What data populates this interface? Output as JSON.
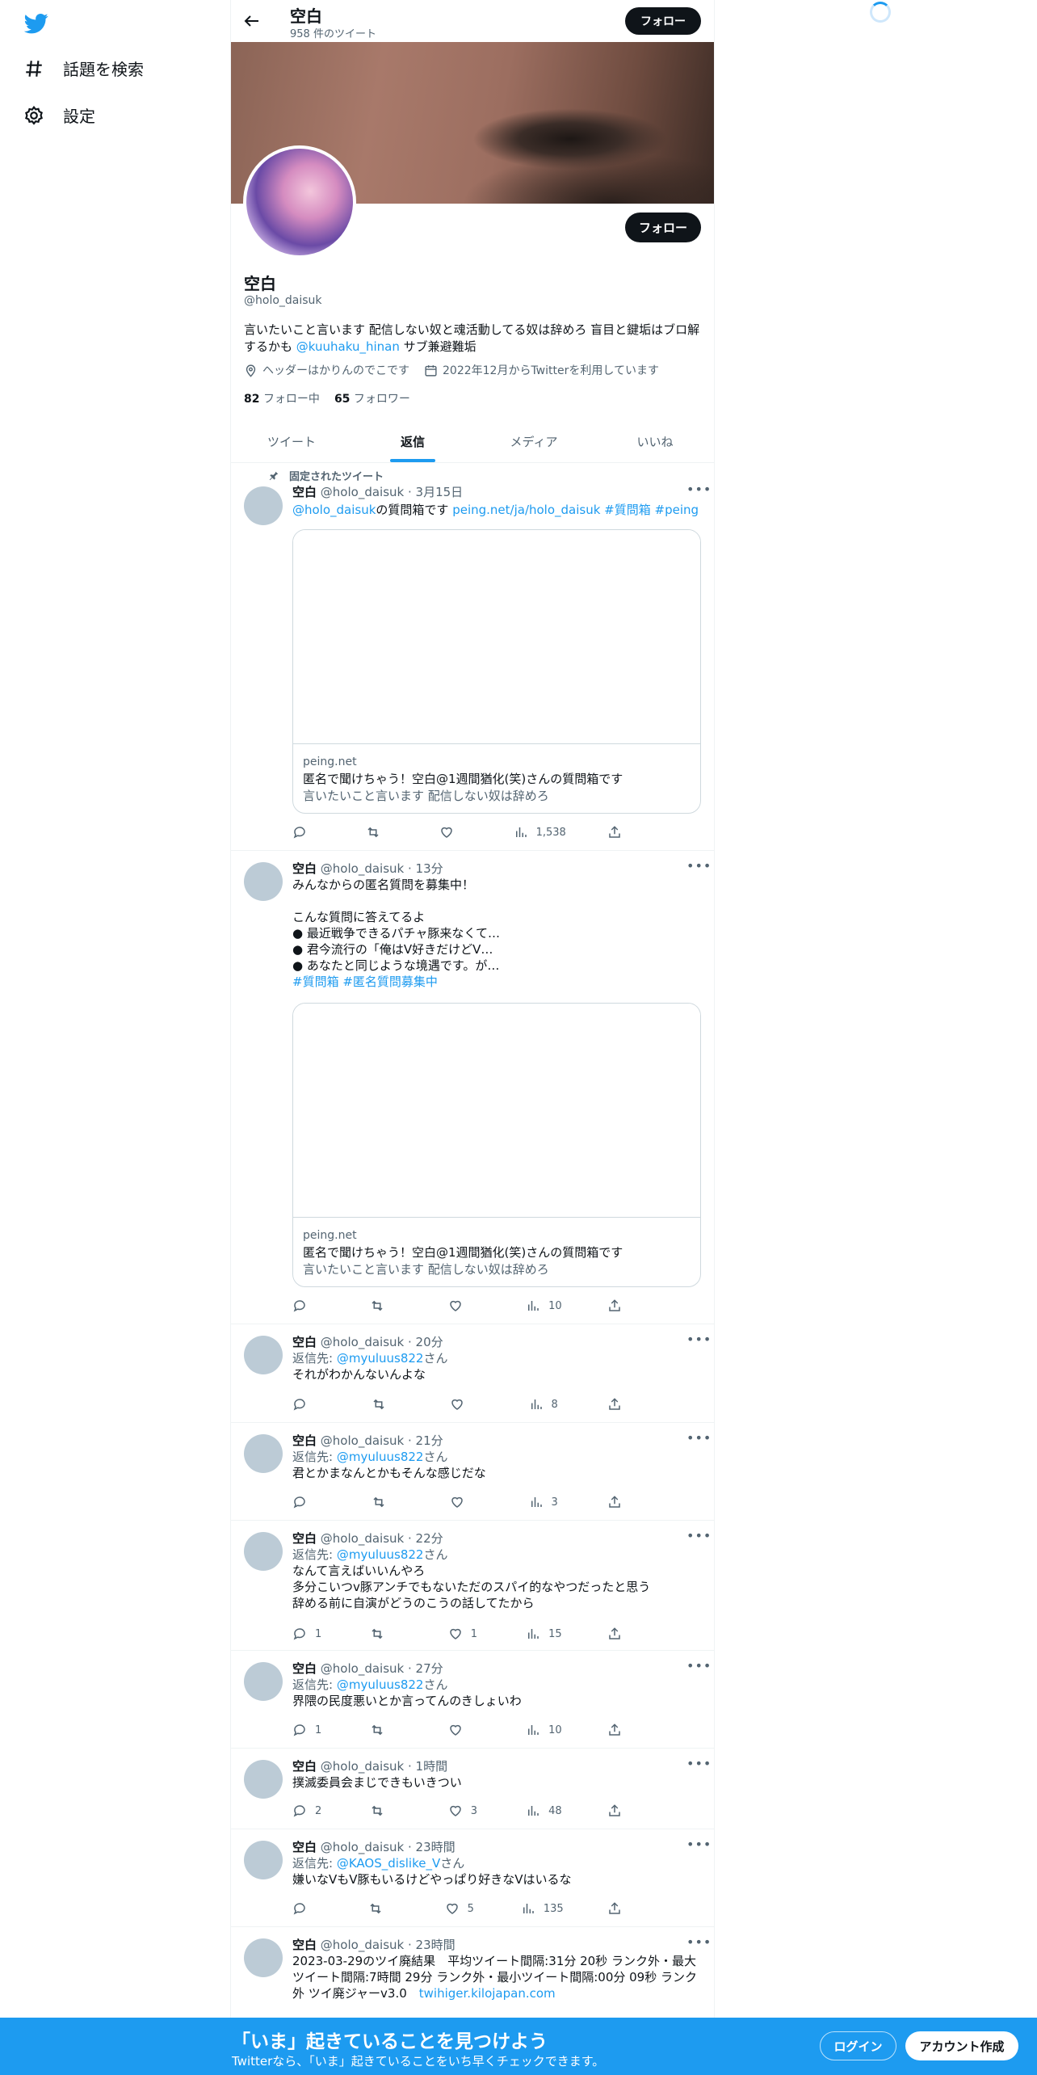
{
  "sidebar": {
    "items": [
      {
        "label": "話題を検索",
        "icon": "hashtag-icon"
      },
      {
        "label": "設定",
        "icon": "gear-icon"
      }
    ]
  },
  "header": {
    "name": "空白",
    "tweet_count": "958 件のツイート",
    "follow_label": "フォロー"
  },
  "profile": {
    "name": "空白",
    "handle": "@holo_daisuk",
    "follow_label": "フォロー",
    "bio_text": "言いたいこと言います 配信しない奴と魂活動してる奴は辞めろ 盲目と鍵垢はブロ解するかも ",
    "bio_mention": "@kuuhaku_hinan",
    "bio_tail": " サブ兼避難垢",
    "location": "ヘッダーはかりんのでこです",
    "joined": "2022年12月からTwitterを利用しています",
    "following_count": "82",
    "following_label": "フォロー中",
    "followers_count": "65",
    "followers_label": "フォロワー"
  },
  "tabs": [
    {
      "label": "ツイート",
      "active": false
    },
    {
      "label": "返信",
      "active": true
    },
    {
      "label": "メディア",
      "active": false
    },
    {
      "label": "いいね",
      "active": false
    }
  ],
  "tweets": [
    {
      "pinned_label": "固定されたツイート",
      "name": "空白",
      "meta": "@holo_daisuk · 3月15日",
      "mention": "@holo_daisuk",
      "text": "の質問箱です ",
      "link": "peing.net/ja/holo_daisuk #質問箱 #peing",
      "card": {
        "domain": "peing.net",
        "title": "匿名で聞けちゃう！空白@1週間猶化(笑)さんの質問箱です",
        "desc": "言いたいこと言います 配信しない奴は辞めろ"
      },
      "replies": "",
      "retweets": "",
      "likes": "",
      "views": "1,538"
    },
    {
      "name": "空白",
      "meta": "@holo_daisuk · 13分",
      "text": "みんなからの匿名質問を募集中！\n\nこんな質問に答えてるよ\n● 最近戦争できるパチャ豚来なくて…\n● 君今流行の「俺はV好きだけどV…\n● あなたと同じような境遇です。が…",
      "hashtags": "#質問箱 #匿名質問募集中",
      "card": {
        "domain": "peing.net",
        "title": "匿名で聞けちゃう！空白@1週間猶化(笑)さんの質問箱です",
        "desc": "言いたいこと言います 配信しない奴は辞めろ"
      },
      "replies": "",
      "retweets": "",
      "likes": "",
      "views": "10"
    },
    {
      "name": "空白",
      "meta": "@holo_daisuk · 20分",
      "reply_prefix": "返信先: ",
      "reply_to": "@myuluus822",
      "reply_suffix": "さん",
      "text": "それがわかんないんよな",
      "replies": "",
      "retweets": "",
      "likes": "",
      "views": "8"
    },
    {
      "name": "空白",
      "meta": "@holo_daisuk · 21分",
      "reply_prefix": "返信先: ",
      "reply_to": "@myuluus822",
      "reply_suffix": "さん",
      "text": "君とかまなんとかもそんな感じだな",
      "replies": "",
      "retweets": "",
      "likes": "",
      "views": "3"
    },
    {
      "name": "空白",
      "meta": "@holo_daisuk · 22分",
      "reply_prefix": "返信先: ",
      "reply_to": "@myuluus822",
      "reply_suffix": "さん",
      "text": "なんて言えばいいんやろ\n多分こいつv豚アンチでもないただのスパイ的なやつだったと思う\n辞める前に自演がどうのこうの話してたから",
      "replies": "1",
      "retweets": "",
      "likes": "1",
      "views": "15"
    },
    {
      "name": "空白",
      "meta": "@holo_daisuk · 27分",
      "reply_prefix": "返信先: ",
      "reply_to": "@myuluus822",
      "reply_suffix": "さん",
      "text": "界隈の民度悪いとか言ってんのきしょいわ",
      "replies": "1",
      "retweets": "",
      "likes": "",
      "views": "10"
    },
    {
      "name": "空白",
      "meta": "@holo_daisuk · 1時間",
      "text": "撲滅委員会まじできもいきつい",
      "replies": "2",
      "retweets": "",
      "likes": "3",
      "views": "48"
    },
    {
      "name": "空白",
      "meta": "@holo_daisuk · 23時間",
      "reply_prefix": "返信先: ",
      "reply_to": "@KAOS_dislike_V",
      "reply_suffix": "さん",
      "text": "嫌いなVもV豚もいるけどやっぱり好きなVはいるな",
      "replies": "",
      "retweets": "",
      "likes": "5",
      "views": "135"
    },
    {
      "name": "空白",
      "meta": "@holo_daisuk · 23時間",
      "text": "2023-03-29のツイ廃結果　平均ツイート間隔:31分 20秒 ランク外・最大ツイート間隔:7時間 29分 ランク外・最小ツイート間隔:00分 09秒 ランク外 ツイ廃ジャーv3.0　",
      "link": "twihiger.kilojapan.com"
    }
  ],
  "bottom_bar": {
    "title": "「いま」起きていることを見つけよう",
    "subtitle": "Twitterなら、「いま」起きていることをいち早くチェックできます。",
    "login": "ログイン",
    "signup": "アカウント作成"
  },
  "colors": {
    "accent": "#1d9bf0",
    "text": "#0f1419",
    "secondary": "#536471"
  }
}
